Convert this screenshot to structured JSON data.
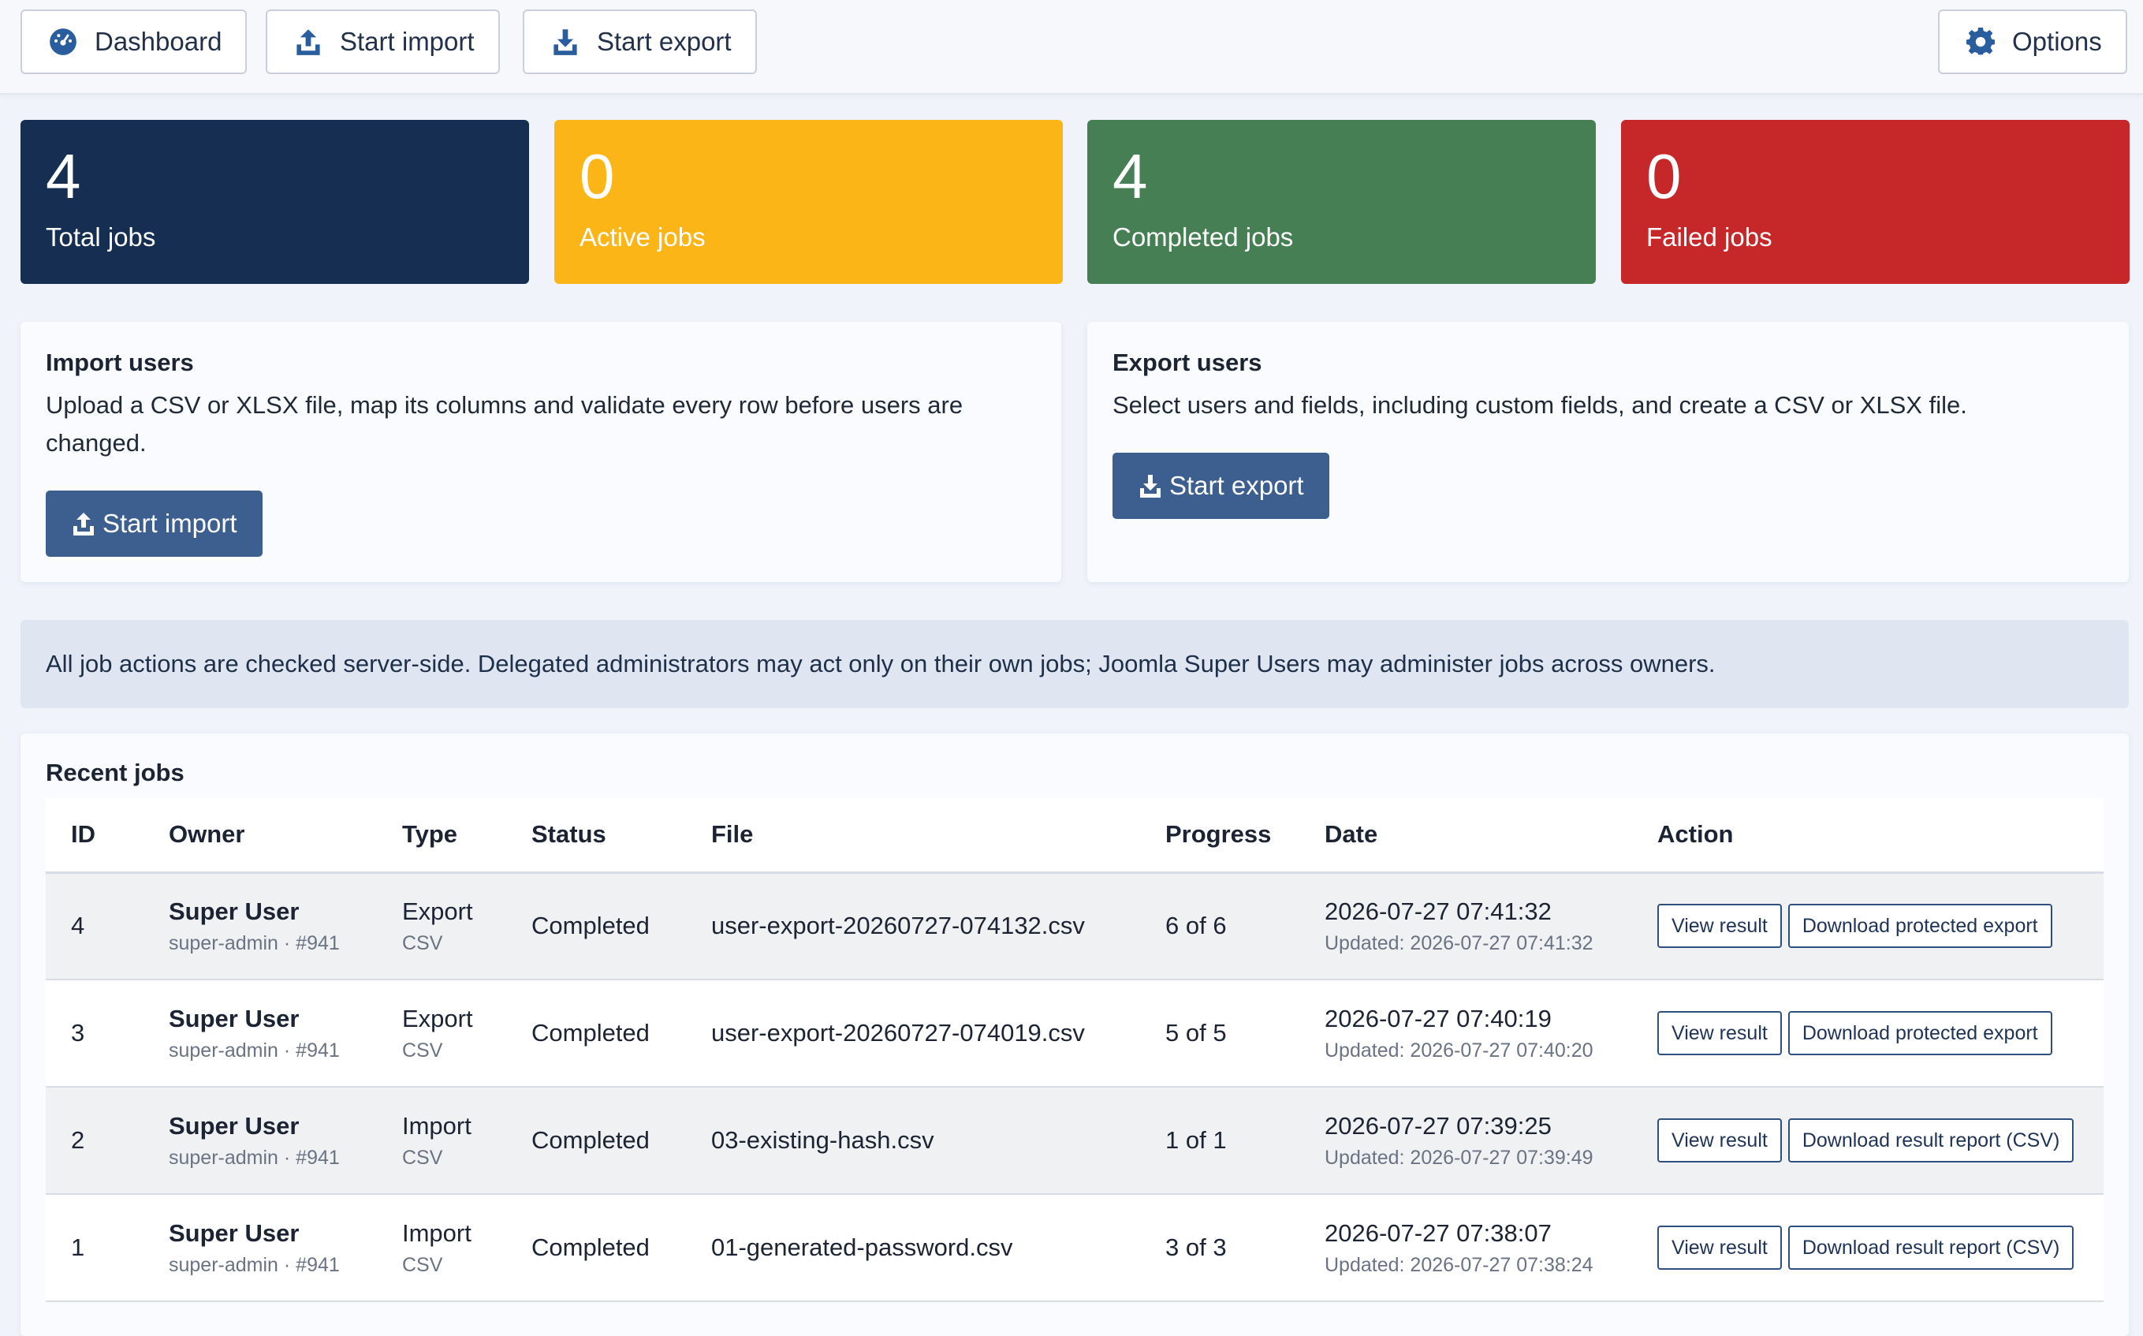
{
  "toolbar": {
    "dashboard": {
      "label": "Dashboard",
      "icon": "dashboard-gauge-icon"
    },
    "start_import": {
      "label": "Start import",
      "icon": "upload-icon"
    },
    "start_export": {
      "label": "Start export",
      "icon": "download-icon"
    },
    "options": {
      "label": "Options",
      "icon": "gear-icon"
    }
  },
  "stats": [
    {
      "value": "4",
      "label": "Total jobs",
      "color": "#152e52"
    },
    {
      "value": "0",
      "label": "Active jobs",
      "color": "#fbb516"
    },
    {
      "value": "4",
      "label": "Completed jobs",
      "color": "#457f53"
    },
    {
      "value": "0",
      "label": "Failed jobs",
      "color": "#c6282a"
    }
  ],
  "import_panel": {
    "title": "Import users",
    "description": "Upload a CSV or XLSX file, map its columns and validate every row before users are changed.",
    "button": "Start import"
  },
  "export_panel": {
    "title": "Export users",
    "description": "Select users and fields, including custom fields, and create a CSV or XLSX file.",
    "button": "Start export"
  },
  "notice": "All job actions are checked server-side. Delegated administrators may act only on their own jobs; Joomla Super Users may administer jobs across owners.",
  "jobs": {
    "title": "Recent jobs",
    "columns": [
      "ID",
      "Owner",
      "Type",
      "Status",
      "File",
      "Progress",
      "Date",
      "Action"
    ],
    "rows": [
      {
        "id": "4",
        "owner": "Super User",
        "owner_sub": "super-admin · #941",
        "type": "Export",
        "format": "CSV",
        "status": "Completed",
        "file": "user-export-20260727-074132.csv",
        "progress": "6 of 6",
        "date": "2026-07-27 07:41:32",
        "updated": "Updated: 2026-07-27 07:41:32",
        "action1": "View result",
        "action2": "Download protected export"
      },
      {
        "id": "3",
        "owner": "Super User",
        "owner_sub": "super-admin · #941",
        "type": "Export",
        "format": "CSV",
        "status": "Completed",
        "file": "user-export-20260727-074019.csv",
        "progress": "5 of 5",
        "date": "2026-07-27 07:40:19",
        "updated": "Updated: 2026-07-27 07:40:20",
        "action1": "View result",
        "action2": "Download protected export"
      },
      {
        "id": "2",
        "owner": "Super User",
        "owner_sub": "super-admin · #941",
        "type": "Import",
        "format": "CSV",
        "status": "Completed",
        "file": "03-existing-hash.csv",
        "progress": "1 of 1",
        "date": "2026-07-27 07:39:25",
        "updated": "Updated: 2026-07-27 07:39:49",
        "action1": "View result",
        "action2": "Download result report (CSV)"
      },
      {
        "id": "1",
        "owner": "Super User",
        "owner_sub": "super-admin · #941",
        "type": "Import",
        "format": "CSV",
        "status": "Completed",
        "file": "01-generated-password.csv",
        "progress": "3 of 3",
        "date": "2026-07-27 07:38:07",
        "updated": "Updated: 2026-07-27 07:38:24",
        "action1": "View result",
        "action2": "Download result report (CSV)"
      }
    ]
  }
}
